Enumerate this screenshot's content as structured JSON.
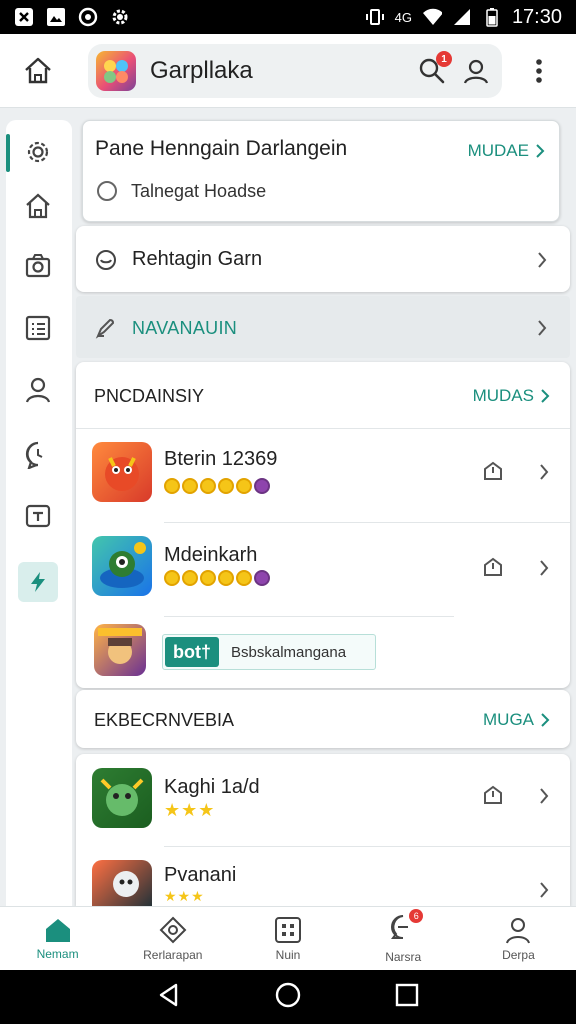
{
  "status_bar": {
    "time": "17:30",
    "network": "4G",
    "icons": [
      "notification-x-icon",
      "image-icon",
      "data-saver-icon",
      "settings-gear-icon",
      "vibrate-icon",
      "wifi-icon",
      "signal-icon",
      "battery-icon"
    ]
  },
  "app_bar": {
    "title": "Garpllaka",
    "notification_count": "1"
  },
  "side_rail": {
    "items": [
      "settings-icon",
      "home-icon",
      "camera-icon",
      "list-icon",
      "profile-icon",
      "chat-icon",
      "arrow-box-icon",
      "bolt-icon"
    ]
  },
  "top_card": {
    "title": "Pane Henngain Darlangein",
    "link": "MUDAE",
    "radio_label": "Talnegat Hoadse"
  },
  "rehtagin": {
    "label": "Rehtagin Garn"
  },
  "navanauin": {
    "label": "NAVANAUIN"
  },
  "section1": {
    "title": "PNCDAINSIY",
    "link": "MUDAS",
    "games": [
      {
        "title": "Bterin 12369"
      },
      {
        "title": "Mdeinkarh"
      }
    ],
    "promo_badge": "bot†",
    "promo_text": "Bsbskalmangana"
  },
  "section2": {
    "title": "EKBECRNVEBIA",
    "link": "MUGA",
    "games": [
      {
        "title": "Kaghi 1a/d",
        "stars": "★★★"
      },
      {
        "title": "Pvanani",
        "stars": "★★★"
      }
    ]
  },
  "bottom_nav": {
    "items": [
      {
        "label": "Nemam",
        "active": true
      },
      {
        "label": "Rerlarapan"
      },
      {
        "label": "Nuin"
      },
      {
        "label": "Narsra",
        "badge": "6"
      },
      {
        "label": "Derpa"
      }
    ]
  },
  "colors": {
    "accent": "#1b8f7e",
    "badge": "#e53935",
    "coin": "#f5c518"
  }
}
